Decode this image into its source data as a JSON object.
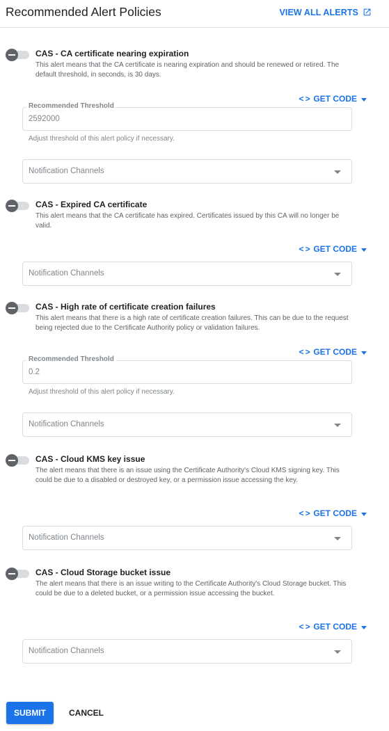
{
  "header": {
    "title": "Recommended Alert Policies",
    "view_all_label": "VIEW ALL ALERTS"
  },
  "colors": {
    "accent": "#1a73e8",
    "toggle_off": "#5f6368",
    "border": "#dadce0"
  },
  "policies": [
    {
      "title": "CAS - CA certificate nearing expiration",
      "description": "This alert means that the CA certificate is nearing expiration and should be renewed or retired. The default threshold, in seconds, is 30 days.",
      "enabled": false,
      "get_code_label": "GET CODE",
      "threshold_label": "Recommended Threshold",
      "threshold_value": "2592000",
      "threshold_helper": "Adjust threshold of this alert policy if necessary.",
      "notification_placeholder": "Notification Channels"
    },
    {
      "title": "CAS - Expired CA certificate",
      "description": "This alert means that the CA certificate has expired. Certificates issued by this CA will no longer be valid.",
      "enabled": false,
      "get_code_label": "GET CODE",
      "notification_placeholder": "Notification Channels"
    },
    {
      "title": "CAS - High rate of certificate creation failures",
      "description": "This alert means that there is a high rate of certificate creation failures. This can be due to the request being rejected due to the Certificate Authority policy or validation failures.",
      "enabled": false,
      "get_code_label": "GET CODE",
      "threshold_label": "Recommended Threshold",
      "threshold_value": "0.2",
      "threshold_helper": "Adjust threshold of this alert policy if necessary.",
      "notification_placeholder": "Notification Channels"
    },
    {
      "title": "CAS - Cloud KMS key issue",
      "description": "The alert means that there is an issue using the Certificate Authority's Cloud KMS signing key. This could be due to a disabled or destroyed key, or a permission issue accessing the key.",
      "enabled": false,
      "get_code_label": "GET CODE",
      "notification_placeholder": "Notification Channels"
    },
    {
      "title": "CAS - Cloud Storage bucket issue",
      "description": "The alert means that there is an issue writing to the Certificate Authority's Cloud Storage bucket. This could be due to a deleted bucket, or a permission issue accessing the bucket.",
      "enabled": false,
      "get_code_label": "GET CODE",
      "notification_placeholder": "Notification Channels"
    }
  ],
  "actions": {
    "submit_label": "SUBMIT",
    "cancel_label": "CANCEL"
  }
}
